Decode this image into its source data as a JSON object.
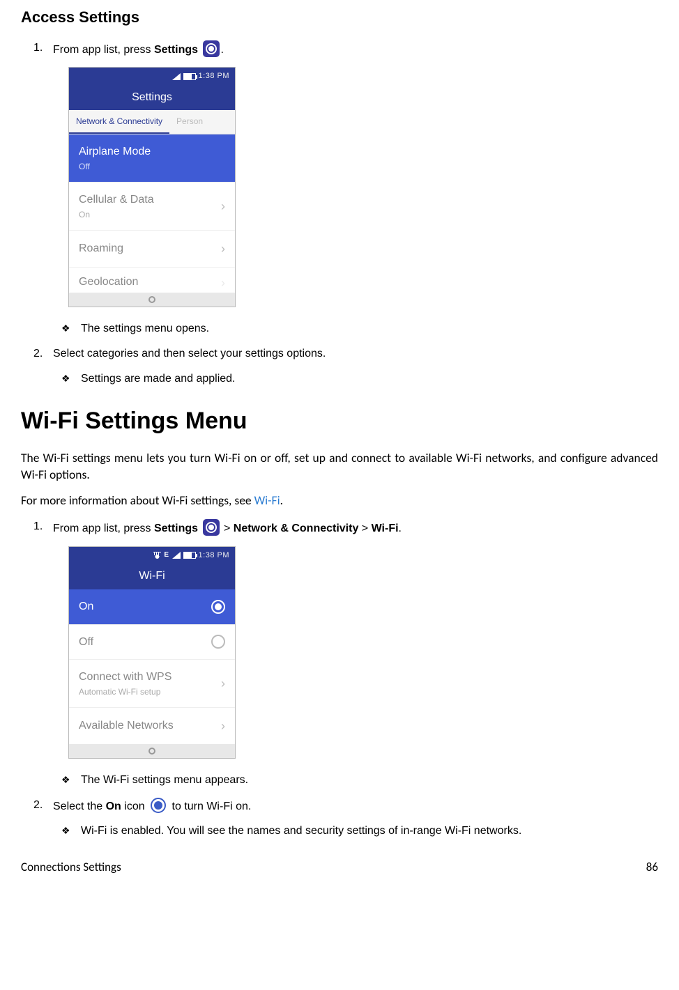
{
  "section1": {
    "title": "Access Settings",
    "step1_pre": "From app list, press ",
    "step1_bold": "Settings",
    "step1_post": ".",
    "bullet1": "The settings menu opens.",
    "step2": "Select categories and then select your settings options.",
    "bullet2": "Settings are made and applied."
  },
  "screenshot1": {
    "time": "1:38 PM",
    "title": "Settings",
    "tab_active": "Network & Connectivity",
    "tab_other": "Person",
    "rows": {
      "airplane": {
        "label": "Airplane Mode",
        "value": "Off"
      },
      "cellular": {
        "label": "Cellular & Data",
        "value": "On"
      },
      "roaming": {
        "label": "Roaming"
      },
      "geo": {
        "label": "Geolocation"
      }
    }
  },
  "section2": {
    "title": "Wi-Fi Settings Menu",
    "intro": "The Wi-Fi settings menu lets you turn Wi-Fi on or off, set up and connect to available Wi-Fi networks, and configure advanced Wi-Fi options.",
    "moreinfo_pre": "For more information about Wi-Fi settings, see ",
    "moreinfo_link": "Wi-Fi",
    "moreinfo_post": ".",
    "step1_pre": "From app list, press ",
    "step1_b1": "Settings",
    "step1_mid1": " > ",
    "step1_b2": "Network & Connectivity",
    "step1_mid2": " > ",
    "step1_b3": "Wi-Fi",
    "step1_post": ".",
    "bullet1": "The Wi-Fi settings menu appears.",
    "step2_pre": "Select the ",
    "step2_bold": "On",
    "step2_mid": " icon ",
    "step2_post": " to turn Wi-Fi on.",
    "bullet2": "Wi-Fi is enabled. You will see the names and security settings of in-range Wi-Fi networks."
  },
  "screenshot2": {
    "time": "1:38 PM",
    "e": "E",
    "title": "Wi-Fi",
    "rows": {
      "on": "On",
      "off": "Off",
      "wps": {
        "label": "Connect with WPS",
        "sub": "Automatic Wi-Fi setup"
      },
      "avail": "Available Networks"
    }
  },
  "footer": {
    "left": "Connections Settings",
    "right": "86"
  }
}
